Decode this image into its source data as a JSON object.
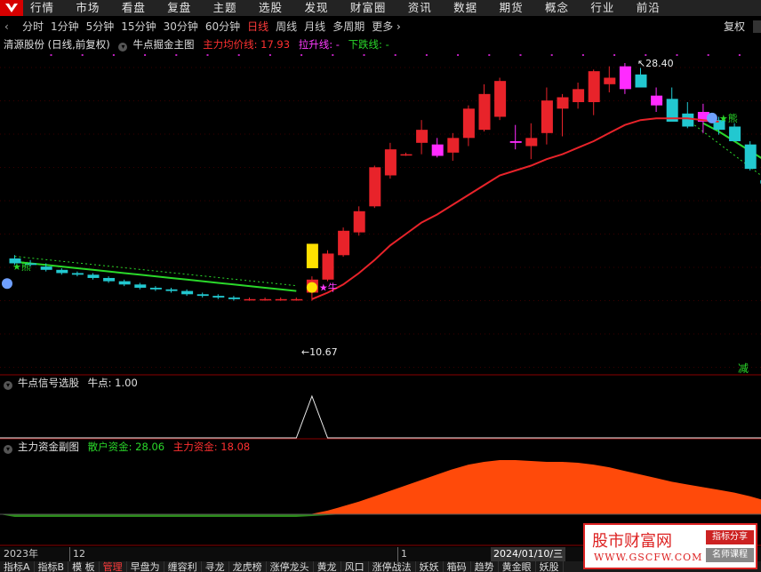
{
  "menu": [
    "行情",
    "市场",
    "看盘",
    "复盘",
    "主题",
    "选股",
    "发现",
    "财富圈",
    "资讯",
    "数据",
    "期货",
    "概念",
    "行业",
    "前沿"
  ],
  "periods": [
    "分时",
    "1分钟",
    "5分钟",
    "15分钟",
    "30分钟",
    "60分钟",
    "日线",
    "周线",
    "月线",
    "多周期",
    "更多 ›"
  ],
  "active_period": "日线",
  "toolbar": {
    "fuquan_label": "复权",
    "back_label": "‹"
  },
  "main_panel": {
    "stock_title": "清源股份 (日线,前复权)",
    "indicator_name": "牛点掘金主图",
    "ma_label": "主力均价线: 17.93",
    "up_label": "拉升线: -",
    "down_label": "下跌线: -",
    "high_label": "28.40",
    "low_label": "10.67",
    "niu_label": "牛",
    "xiong_label": "熊",
    "xiong_label_left": "熊",
    "jian_label": "减"
  },
  "signal_panel": {
    "title": "牛点信号选股",
    "value_label": "牛点: 1.00"
  },
  "fund_panel": {
    "title": "主力资金副图",
    "retail_label": "散户资金: 28.06",
    "main_label": "主力资金: 18.08"
  },
  "datebar": {
    "year": "2023年",
    "month12": "12",
    "month1": "1",
    "cursor_date": "2024/01/10/三"
  },
  "tabs": [
    "指标A",
    "指标B",
    "模 板",
    "管理",
    "早盘为",
    "缠容利",
    "寻龙",
    "龙虎榜",
    "涨停龙头",
    "黄龙",
    "风口",
    "涨停战法",
    "妖妖",
    "箱码",
    "趋势",
    "黄金眼",
    "妖股"
  ],
  "active_tab": "管理",
  "watermark": {
    "title": "股市财富网",
    "url": "WWW.GSCFW.COM",
    "tag1": "指标分享",
    "tag2": "名师课程"
  },
  "colors": {
    "up": "#e8232a",
    "down": "#22c8d0",
    "ma": "#e8232a",
    "bear_line": "#2ad82a",
    "signal_bar": "#ff2bff",
    "fund": "#ff4a0a",
    "retail": "#2a8a1a"
  },
  "chart_data": {
    "type": "candlestick",
    "candles": [
      {
        "o": 16.4,
        "h": 16.6,
        "l": 16.0,
        "c": 16.1
      },
      {
        "o": 16.1,
        "h": 16.3,
        "l": 15.9,
        "c": 16.0
      },
      {
        "o": 15.9,
        "h": 16.1,
        "l": 15.6,
        "c": 15.7
      },
      {
        "o": 15.7,
        "h": 15.8,
        "l": 15.4,
        "c": 15.5
      },
      {
        "o": 15.5,
        "h": 15.6,
        "l": 15.3,
        "c": 15.4
      },
      {
        "o": 15.4,
        "h": 15.5,
        "l": 15.1,
        "c": 15.2
      },
      {
        "o": 15.2,
        "h": 15.3,
        "l": 14.9,
        "c": 15.0
      },
      {
        "o": 15.0,
        "h": 15.1,
        "l": 14.7,
        "c": 14.8
      },
      {
        "o": 14.8,
        "h": 14.9,
        "l": 14.5,
        "c": 14.6
      },
      {
        "o": 14.6,
        "h": 14.7,
        "l": 14.4,
        "c": 14.5
      },
      {
        "o": 14.5,
        "h": 14.6,
        "l": 14.3,
        "c": 14.4
      },
      {
        "o": 14.4,
        "h": 14.5,
        "l": 14.1,
        "c": 14.2
      },
      {
        "o": 14.2,
        "h": 14.3,
        "l": 14.0,
        "c": 14.1
      },
      {
        "o": 14.1,
        "h": 14.2,
        "l": 13.9,
        "c": 14.0
      },
      {
        "o": 14.0,
        "h": 14.1,
        "l": 13.8,
        "c": 13.9
      },
      {
        "o": 13.9,
        "h": 14.0,
        "l": 13.8,
        "c": 13.9
      },
      {
        "o": 13.9,
        "h": 14.0,
        "l": 13.8,
        "c": 13.9
      },
      {
        "o": 13.9,
        "h": 14.0,
        "l": 13.8,
        "c": 13.9
      },
      {
        "o": 13.9,
        "h": 14.0,
        "l": 13.8,
        "c": 13.9
      },
      {
        "o": 14.3,
        "h": 15.3,
        "l": 13.8,
        "c": 15.1
      },
      {
        "o": 15.1,
        "h": 16.9,
        "l": 15.0,
        "c": 16.7
      },
      {
        "o": 16.6,
        "h": 18.3,
        "l": 16.5,
        "c": 18.1
      },
      {
        "o": 18.0,
        "h": 19.6,
        "l": 17.8,
        "c": 19.3
      },
      {
        "o": 19.6,
        "h": 22.1,
        "l": 19.5,
        "c": 22.0
      },
      {
        "o": 21.5,
        "h": 23.5,
        "l": 21.3,
        "c": 23.1
      },
      {
        "o": 22.8,
        "h": 22.9,
        "l": 22.7,
        "c": 22.8
      },
      {
        "o": 23.5,
        "h": 24.9,
        "l": 22.8,
        "c": 24.3
      },
      {
        "o": 23.4,
        "h": 23.8,
        "l": 22.6,
        "c": 22.7
      },
      {
        "o": 22.9,
        "h": 24.1,
        "l": 22.4,
        "c": 23.8
      },
      {
        "o": 23.8,
        "h": 25.8,
        "l": 23.3,
        "c": 25.6
      },
      {
        "o": 24.3,
        "h": 27.1,
        "l": 24.2,
        "c": 26.5
      },
      {
        "o": 25.1,
        "h": 27.5,
        "l": 24.9,
        "c": 27.3
      },
      {
        "o": 23.6,
        "h": 24.6,
        "l": 23.1,
        "c": 23.5
      },
      {
        "o": 23.3,
        "h": 24.7,
        "l": 22.5,
        "c": 23.8
      },
      {
        "o": 24.1,
        "h": 26.9,
        "l": 23.4,
        "c": 26.1
      },
      {
        "o": 25.6,
        "h": 26.5,
        "l": 23.9,
        "c": 26.3
      },
      {
        "o": 26.0,
        "h": 27.2,
        "l": 25.6,
        "c": 26.8
      },
      {
        "o": 26.0,
        "h": 28.0,
        "l": 25.2,
        "c": 27.9
      },
      {
        "o": 27.1,
        "h": 28.2,
        "l": 26.6,
        "c": 27.5
      },
      {
        "o": 26.8,
        "h": 28.4,
        "l": 26.5,
        "c": 28.2
      },
      {
        "o": 27.7,
        "h": 28.1,
        "l": 26.9,
        "c": 26.9
      },
      {
        "o": 26.4,
        "h": 26.9,
        "l": 25.4,
        "c": 25.8
      },
      {
        "o": 26.2,
        "h": 26.9,
        "l": 25.2,
        "c": 24.8
      },
      {
        "o": 25.3,
        "h": 26.0,
        "l": 24.4,
        "c": 24.5
      },
      {
        "o": 25.4,
        "h": 25.9,
        "l": 24.1,
        "c": 24.8
      },
      {
        "o": 24.9,
        "h": 25.1,
        "l": 24.0,
        "c": 24.3
      },
      {
        "o": 24.5,
        "h": 24.7,
        "l": 23.7,
        "c": 23.6
      },
      {
        "o": 23.4,
        "h": 23.6,
        "l": 21.8,
        "c": 21.9
      },
      {
        "o": 21.2,
        "h": 21.3,
        "l": 20.9,
        "c": 21.0
      },
      {
        "o": 21.0,
        "h": 21.1,
        "l": 20.3,
        "c": 20.4
      },
      {
        "o": 20.6,
        "h": 20.8,
        "l": 19.9,
        "c": 20.3
      },
      {
        "o": 19.8,
        "h": 19.9,
        "l": 19.0,
        "c": 19.1
      }
    ],
    "signal_candles": [
      27,
      32,
      39,
      41,
      44
    ],
    "yellow_candle": 19,
    "ma_line": [
      null,
      null,
      null,
      null,
      null,
      null,
      null,
      null,
      null,
      null,
      null,
      null,
      null,
      null,
      null,
      null,
      null,
      null,
      null,
      13.9,
      14.3,
      14.8,
      15.5,
      16.3,
      17.2,
      17.9,
      18.6,
      19.1,
      19.7,
      20.3,
      20.9,
      21.5,
      21.8,
      22.1,
      22.5,
      22.8,
      23.2,
      23.6,
      24.1,
      24.6,
      24.9,
      25.0,
      25.0,
      25.0,
      24.9,
      24.8
    ],
    "bear_line": [
      16.2,
      16.1,
      16.0,
      15.9,
      15.8,
      15.7,
      15.6,
      15.5,
      15.4,
      15.3,
      15.2,
      15.1,
      15.0,
      14.9,
      14.8,
      14.7,
      14.6,
      14.5,
      14.4,
      null,
      null,
      null,
      null,
      null,
      null,
      null,
      null,
      null,
      null,
      null,
      null,
      null,
      null,
      null,
      null,
      null,
      null,
      null,
      null,
      null,
      null,
      null,
      null,
      null,
      24.7,
      24.2,
      23.6,
      23.0,
      22.4,
      21.8,
      21.2,
      20.6
    ],
    "signal_values": [
      0,
      0,
      0,
      0,
      0,
      0,
      0,
      0,
      0,
      0,
      0,
      0,
      0,
      0,
      0,
      0,
      0,
      0,
      0,
      1,
      0,
      0,
      0,
      0,
      0,
      0,
      0,
      0,
      0,
      0,
      0,
      0,
      0,
      0,
      0,
      0,
      0,
      0,
      0,
      0,
      0,
      0,
      0,
      0,
      0,
      0,
      0,
      0,
      0,
      0,
      0,
      0
    ],
    "fund_main": [
      0,
      0,
      0,
      0,
      0,
      0,
      0,
      0,
      0,
      0,
      0,
      0,
      0,
      0,
      0,
      0,
      0,
      0,
      0,
      0.5,
      4,
      9,
      14,
      20,
      26,
      32,
      38,
      44,
      50,
      55,
      58,
      60,
      60,
      59,
      58,
      58,
      57,
      55,
      52,
      48,
      44,
      40,
      36,
      33,
      30,
      27,
      24,
      20,
      15,
      10,
      5,
      2
    ],
    "fund_retail": [
      3,
      3,
      3,
      3,
      3,
      3,
      3,
      3,
      3,
      3,
      3,
      3,
      3,
      3,
      3,
      3,
      3,
      3,
      3,
      2,
      1,
      0,
      0,
      0,
      0,
      0,
      0,
      0,
      0,
      0,
      0,
      0,
      0,
      0,
      0,
      0,
      0,
      0,
      0,
      0,
      0,
      0,
      0,
      0,
      0,
      0,
      0,
      0,
      0,
      1,
      2,
      3
    ]
  }
}
